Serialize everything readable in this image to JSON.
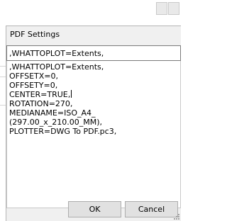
{
  "dialog": {
    "title": "PDF Settings",
    "input_value": ",WHATTOPLOT=Extents,",
    "text_lines": [
      ",WHATTOPLOT=Extents,",
      "OFFSETX=0,",
      "OFFSETY=0,",
      "CENTER=TRUE,",
      "ROTATION=270,",
      "MEDIANAME=ISO_A4_",
      "(297.00_x_210.00_MM),",
      "PLOTTER=DWG To PDF.pc3,"
    ],
    "ok_label": "OK",
    "cancel_label": "Cancel"
  }
}
